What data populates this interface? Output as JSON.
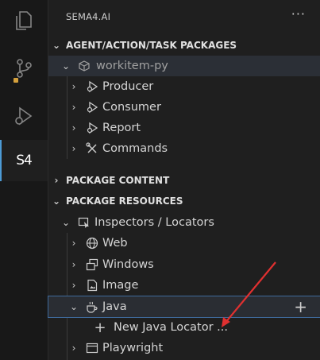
{
  "activity": {
    "items": [
      {
        "name": "explorer-icon"
      },
      {
        "name": "source-control-icon"
      },
      {
        "name": "run-debug-icon"
      },
      {
        "name": "sema4-icon",
        "label": "S4"
      }
    ],
    "badge_color": "#d4a03c"
  },
  "sidebar": {
    "title": "SEMA4.AI",
    "more": "···"
  },
  "sections": {
    "packages": "AGENT/ACTION/TASK PACKAGES",
    "content": "PACKAGE CONTENT",
    "resources": "PACKAGE RESOURCES"
  },
  "packages": {
    "root": "workitem-py",
    "tasks": [
      "Producer",
      "Consumer",
      "Report",
      "Commands"
    ]
  },
  "resources": {
    "inspectors": "Inspectors / Locators",
    "items": [
      "Web",
      "Windows",
      "Image",
      "Java",
      "Playwright"
    ],
    "new_java": "New Java Locator ..."
  },
  "colors": {
    "accent": "#4d9bd6",
    "arrow": "#e03030"
  }
}
